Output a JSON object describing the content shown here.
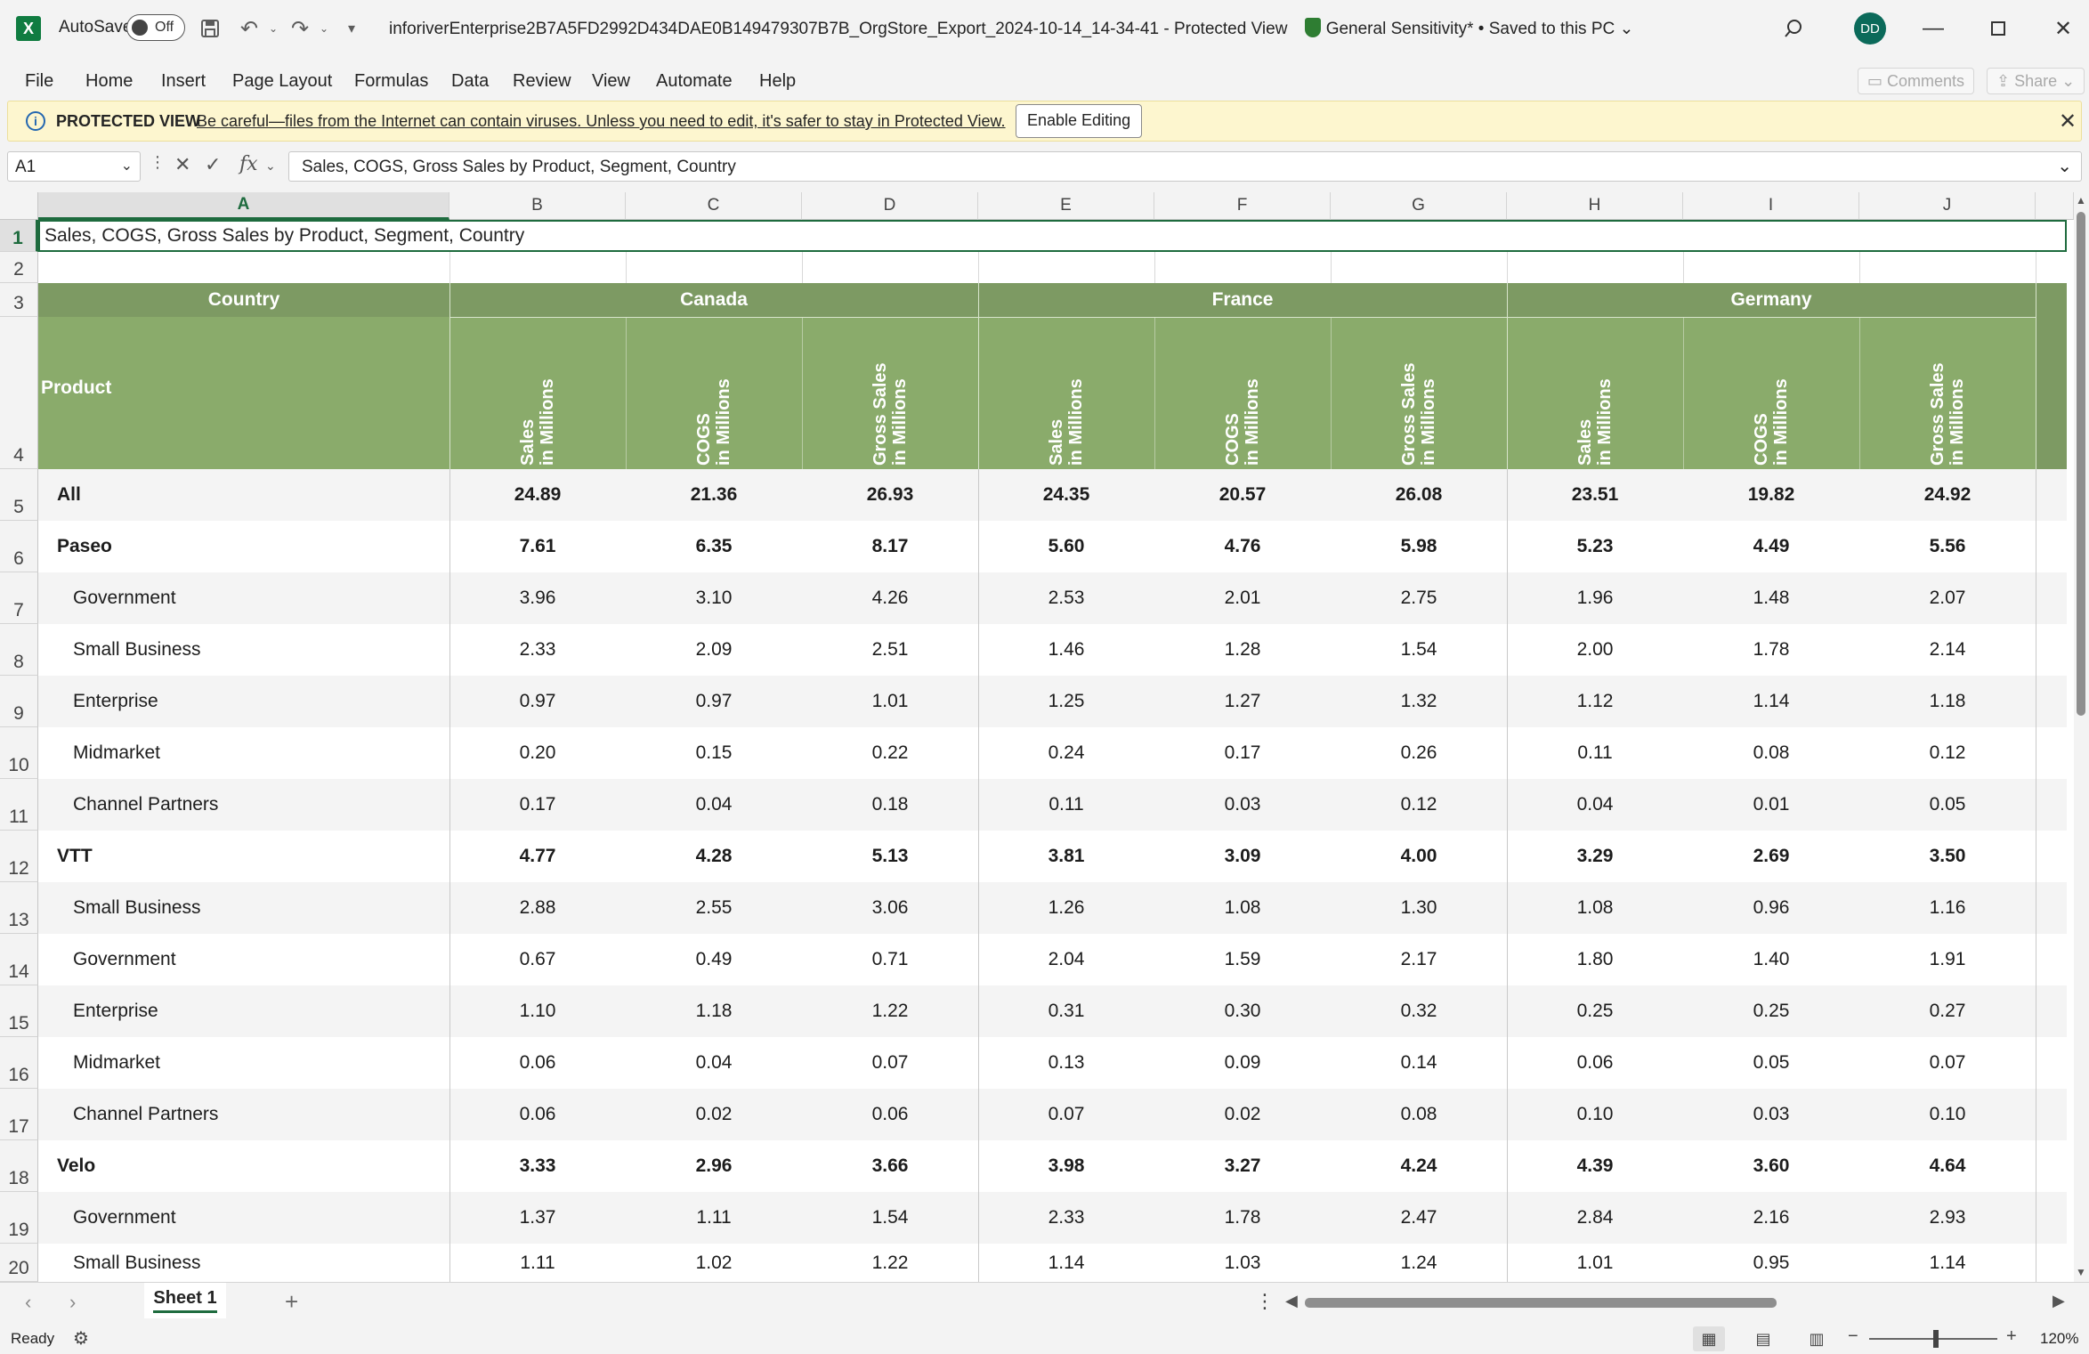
{
  "titlebar": {
    "app_letter": "X",
    "autosave_label": "AutoSave",
    "autosave_state": "Off",
    "doc_title": "inforiverEnterprise2B7A5FD2992D434DAE0B149479307B7B_OrgStore_Export_2024-10-14_14-34-41",
    "protected_view": "Protected View",
    "sensitivity": "General Sensitivity* • Saved to this PC",
    "user_initials": "DD"
  },
  "menu": [
    "File",
    "Home",
    "Insert",
    "Page Layout",
    "Formulas",
    "Data",
    "Review",
    "View",
    "Automate",
    "Help"
  ],
  "ribbon_right": {
    "comments": "Comments",
    "share": "Share"
  },
  "protected_bar": {
    "title": "PROTECTED VIEW",
    "message": "Be careful—files from the Internet can contain viruses. Unless you need to edit, it's safer to stay in Protected View.",
    "enable_button": "Enable Editing"
  },
  "formula_bar": {
    "cell_ref": "A1",
    "fx": "fx",
    "content": "Sales, COGS, Gross Sales by Product, Segment, Country"
  },
  "columns": [
    "A",
    "B",
    "C",
    "D",
    "E",
    "F",
    "G",
    "H",
    "I",
    "J"
  ],
  "rows": [
    "1",
    "2",
    "3",
    "4",
    "5",
    "6",
    "7",
    "8",
    "9",
    "10",
    "11",
    "12",
    "13",
    "14",
    "15",
    "16",
    "17",
    "18",
    "19",
    "20"
  ],
  "sheet": {
    "title": "Sales, COGS, Gross Sales by Product, Segment, Country",
    "country_header": "Country",
    "product_header": "Product",
    "countries": [
      "Canada",
      "France",
      "Germany"
    ],
    "measures": [
      {
        "line1": "Sales",
        "line2": "in Millions"
      },
      {
        "line1": "COGS",
        "line2": "in Millions"
      },
      {
        "line1": "Gross Sales",
        "line2": "in Millions"
      }
    ],
    "data_rows": [
      {
        "label": "All",
        "level": 0,
        "bold": true,
        "values": [
          "24.89",
          "21.36",
          "26.93",
          "24.35",
          "20.57",
          "26.08",
          "23.51",
          "19.82",
          "24.92"
        ]
      },
      {
        "label": "Paseo",
        "level": 0,
        "bold": true,
        "values": [
          "7.61",
          "6.35",
          "8.17",
          "5.60",
          "4.76",
          "5.98",
          "5.23",
          "4.49",
          "5.56"
        ]
      },
      {
        "label": "Government",
        "level": 1,
        "bold": false,
        "values": [
          "3.96",
          "3.10",
          "4.26",
          "2.53",
          "2.01",
          "2.75",
          "1.96",
          "1.48",
          "2.07"
        ]
      },
      {
        "label": "Small Business",
        "level": 1,
        "bold": false,
        "values": [
          "2.33",
          "2.09",
          "2.51",
          "1.46",
          "1.28",
          "1.54",
          "2.00",
          "1.78",
          "2.14"
        ]
      },
      {
        "label": "Enterprise",
        "level": 1,
        "bold": false,
        "values": [
          "0.97",
          "0.97",
          "1.01",
          "1.25",
          "1.27",
          "1.32",
          "1.12",
          "1.14",
          "1.18"
        ]
      },
      {
        "label": "Midmarket",
        "level": 1,
        "bold": false,
        "values": [
          "0.20",
          "0.15",
          "0.22",
          "0.24",
          "0.17",
          "0.26",
          "0.11",
          "0.08",
          "0.12"
        ]
      },
      {
        "label": "Channel Partners",
        "level": 1,
        "bold": false,
        "values": [
          "0.17",
          "0.04",
          "0.18",
          "0.11",
          "0.03",
          "0.12",
          "0.04",
          "0.01",
          "0.05"
        ]
      },
      {
        "label": "VTT",
        "level": 0,
        "bold": true,
        "values": [
          "4.77",
          "4.28",
          "5.13",
          "3.81",
          "3.09",
          "4.00",
          "3.29",
          "2.69",
          "3.50"
        ]
      },
      {
        "label": "Small Business",
        "level": 1,
        "bold": false,
        "values": [
          "2.88",
          "2.55",
          "3.06",
          "1.26",
          "1.08",
          "1.30",
          "1.08",
          "0.96",
          "1.16"
        ]
      },
      {
        "label": "Government",
        "level": 1,
        "bold": false,
        "values": [
          "0.67",
          "0.49",
          "0.71",
          "2.04",
          "1.59",
          "2.17",
          "1.80",
          "1.40",
          "1.91"
        ]
      },
      {
        "label": "Enterprise",
        "level": 1,
        "bold": false,
        "values": [
          "1.10",
          "1.18",
          "1.22",
          "0.31",
          "0.30",
          "0.32",
          "0.25",
          "0.25",
          "0.27"
        ]
      },
      {
        "label": "Midmarket",
        "level": 1,
        "bold": false,
        "values": [
          "0.06",
          "0.04",
          "0.07",
          "0.13",
          "0.09",
          "0.14",
          "0.06",
          "0.05",
          "0.07"
        ]
      },
      {
        "label": "Channel Partners",
        "level": 1,
        "bold": false,
        "values": [
          "0.06",
          "0.02",
          "0.06",
          "0.07",
          "0.02",
          "0.08",
          "0.10",
          "0.03",
          "0.10"
        ]
      },
      {
        "label": "Velo",
        "level": 0,
        "bold": true,
        "values": [
          "3.33",
          "2.96",
          "3.66",
          "3.98",
          "3.27",
          "4.24",
          "4.39",
          "3.60",
          "4.64"
        ]
      },
      {
        "label": "Government",
        "level": 1,
        "bold": false,
        "values": [
          "1.37",
          "1.11",
          "1.54",
          "2.33",
          "1.78",
          "2.47",
          "2.84",
          "2.16",
          "2.93"
        ]
      },
      {
        "label": "Small Business",
        "level": 1,
        "bold": false,
        "values": [
          "1.11",
          "1.02",
          "1.22",
          "1.14",
          "1.03",
          "1.24",
          "1.01",
          "0.95",
          "1.14"
        ]
      }
    ]
  },
  "sheet_tabs": {
    "active": "Sheet 1"
  },
  "status": {
    "ready": "Ready",
    "zoom": "120%"
  },
  "colors": {
    "header_green": "#8aab6b",
    "accent": "#1e6b3e",
    "pv_yellow": "#fdf6cf"
  }
}
